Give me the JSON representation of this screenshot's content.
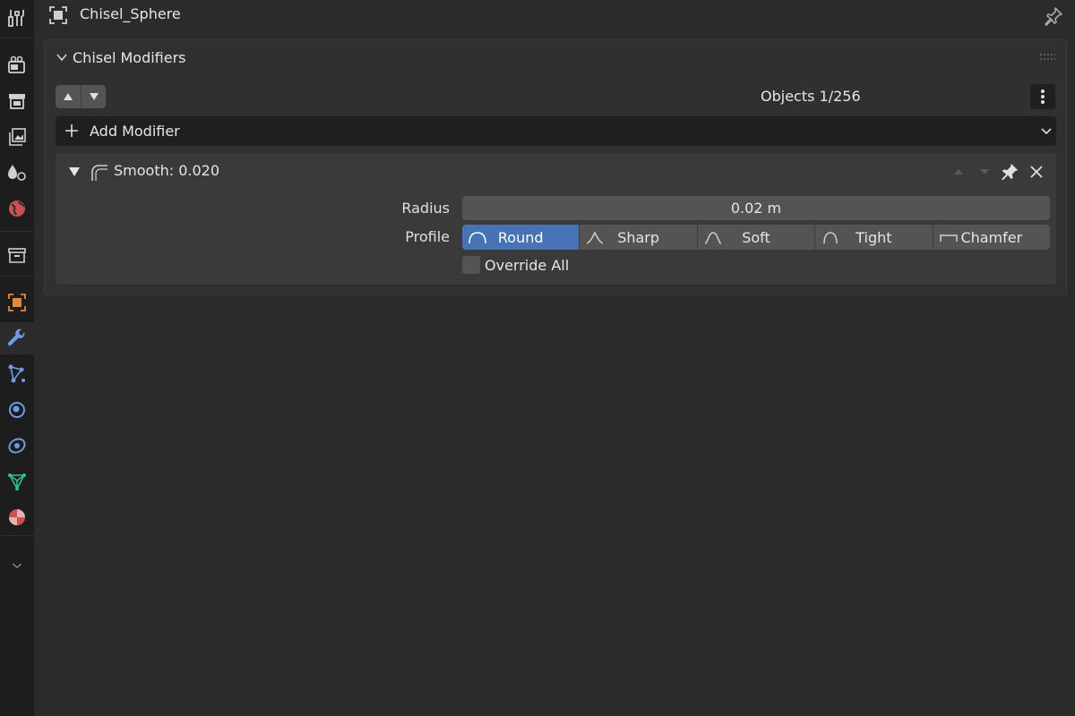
{
  "header": {
    "object_name": "Chisel_Sphere",
    "object_icon": "object-data-icon",
    "pin_icon": "pin-icon"
  },
  "tabs": [
    {
      "name": "tool",
      "icon": "tool-icon",
      "active": false
    },
    {
      "name": "render",
      "icon": "render-icon",
      "active": false
    },
    {
      "name": "output",
      "icon": "output-icon",
      "active": false
    },
    {
      "name": "view-layer",
      "icon": "view-layer-icon",
      "active": false
    },
    {
      "name": "scene",
      "icon": "scene-icon",
      "active": false
    },
    {
      "name": "world",
      "icon": "world-icon",
      "active": false
    },
    {
      "name": "collection",
      "icon": "collection-icon",
      "active": false
    },
    {
      "name": "object",
      "icon": "object-icon",
      "active": false
    },
    {
      "name": "modifiers",
      "icon": "wrench-icon",
      "active": true
    },
    {
      "name": "particles",
      "icon": "particles-icon",
      "active": false
    },
    {
      "name": "physics",
      "icon": "physics-icon",
      "active": false
    },
    {
      "name": "constraints",
      "icon": "constraints-icon",
      "active": false
    },
    {
      "name": "data",
      "icon": "mesh-data-icon",
      "active": false
    },
    {
      "name": "material",
      "icon": "material-icon",
      "active": false
    }
  ],
  "panel": {
    "title": "Chisel Modifiers",
    "objects_count": "Objects 1/256",
    "add_modifier_label": "Add Modifier"
  },
  "modifier": {
    "name": "Smooth: 0.020",
    "radius_label": "Radius",
    "radius_value": "0.02 m",
    "profile_label": "Profile",
    "profiles": [
      {
        "label": "Round",
        "selected": true
      },
      {
        "label": "Sharp",
        "selected": false
      },
      {
        "label": "Soft",
        "selected": false
      },
      {
        "label": "Tight",
        "selected": false
      },
      {
        "label": "Chamfer",
        "selected": false
      }
    ],
    "override_label": "Override All",
    "override_checked": false
  },
  "colors": {
    "accent": "#4772b3",
    "object_orange": "#e08a3c",
    "wrench_blue": "#6f9ae6",
    "world_red": "#c85252",
    "mesh_green": "#2fbf8f"
  }
}
